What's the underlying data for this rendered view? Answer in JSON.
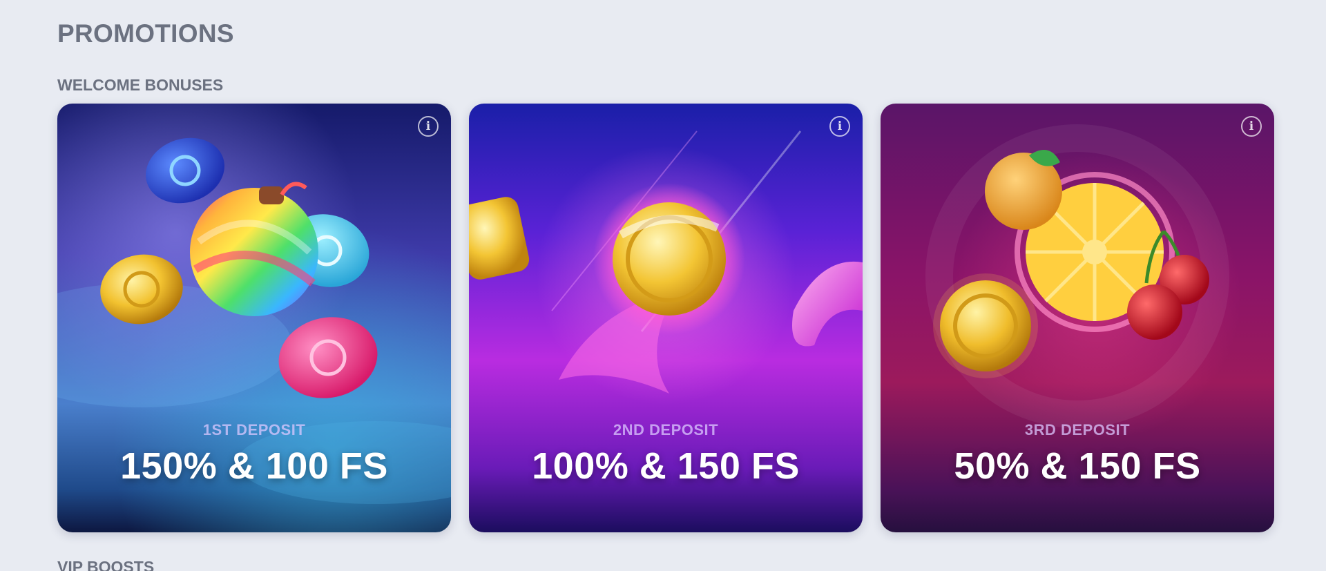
{
  "page": {
    "title": "PROMOTIONS"
  },
  "sections": {
    "welcome": {
      "title": "WELCOME BONUSES"
    },
    "vip": {
      "title": "VIP BOOSTS"
    }
  },
  "cards": [
    {
      "subtitle": "1ST DEPOSIT",
      "offer": "150% & 100 FS",
      "theme": "blue-candy-bomb",
      "colors": {
        "top": "#151a6a",
        "bottom": "#0d1740"
      }
    },
    {
      "subtitle": "2ND DEPOSIT",
      "offer": "100% & 150 FS",
      "theme": "purple-pink-coin",
      "colors": {
        "top": "#1a1fa8",
        "bottom": "#1b0d5e"
      }
    },
    {
      "subtitle": "3RD DEPOSIT",
      "offer": "50% & 150 FS",
      "theme": "magenta-fruits",
      "colors": {
        "top": "#5a1568",
        "bottom": "#26103e"
      }
    }
  ],
  "icons": {
    "info": "info-icon"
  }
}
